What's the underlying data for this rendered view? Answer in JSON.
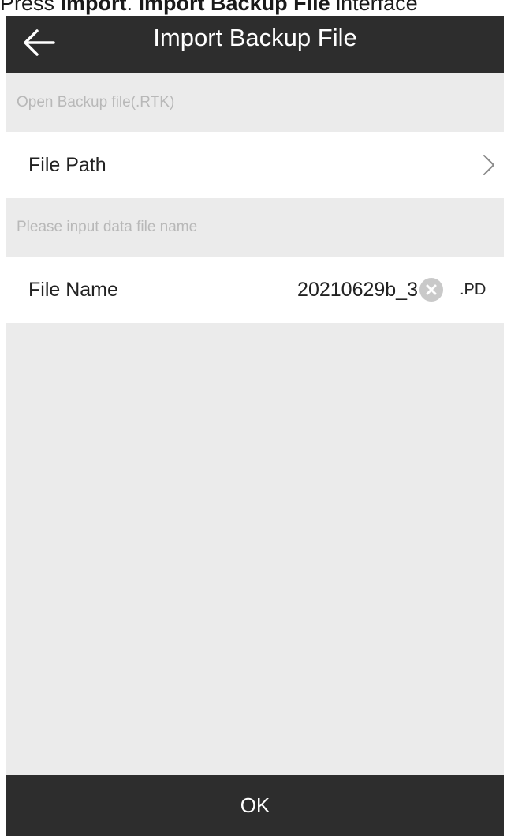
{
  "caption": {
    "prefix": "Press ",
    "bold_1": "Import",
    "mid": ". ",
    "bold_2": "Import Backup File",
    "suffix": " interface"
  },
  "appbar": {
    "back_icon": "arrow-left-icon",
    "title": "Import Backup File"
  },
  "sections": {
    "open_backup_label": "Open Backup file(.RTK)",
    "input_name_label": "Please input data file name"
  },
  "file_path": {
    "label": "File Path",
    "chevron_icon": "chevron-right-icon"
  },
  "file_name": {
    "label": "File Name",
    "value": "20210629b_3",
    "clear_icon": "clear-circle-icon",
    "extension": ".PD"
  },
  "footer": {
    "ok_label": "OK"
  },
  "colors": {
    "appbar_bg": "#2d2d2d",
    "page_bg": "#ebebeb",
    "row_bg": "#ffffff",
    "hint_text": "#b8b8b8"
  }
}
